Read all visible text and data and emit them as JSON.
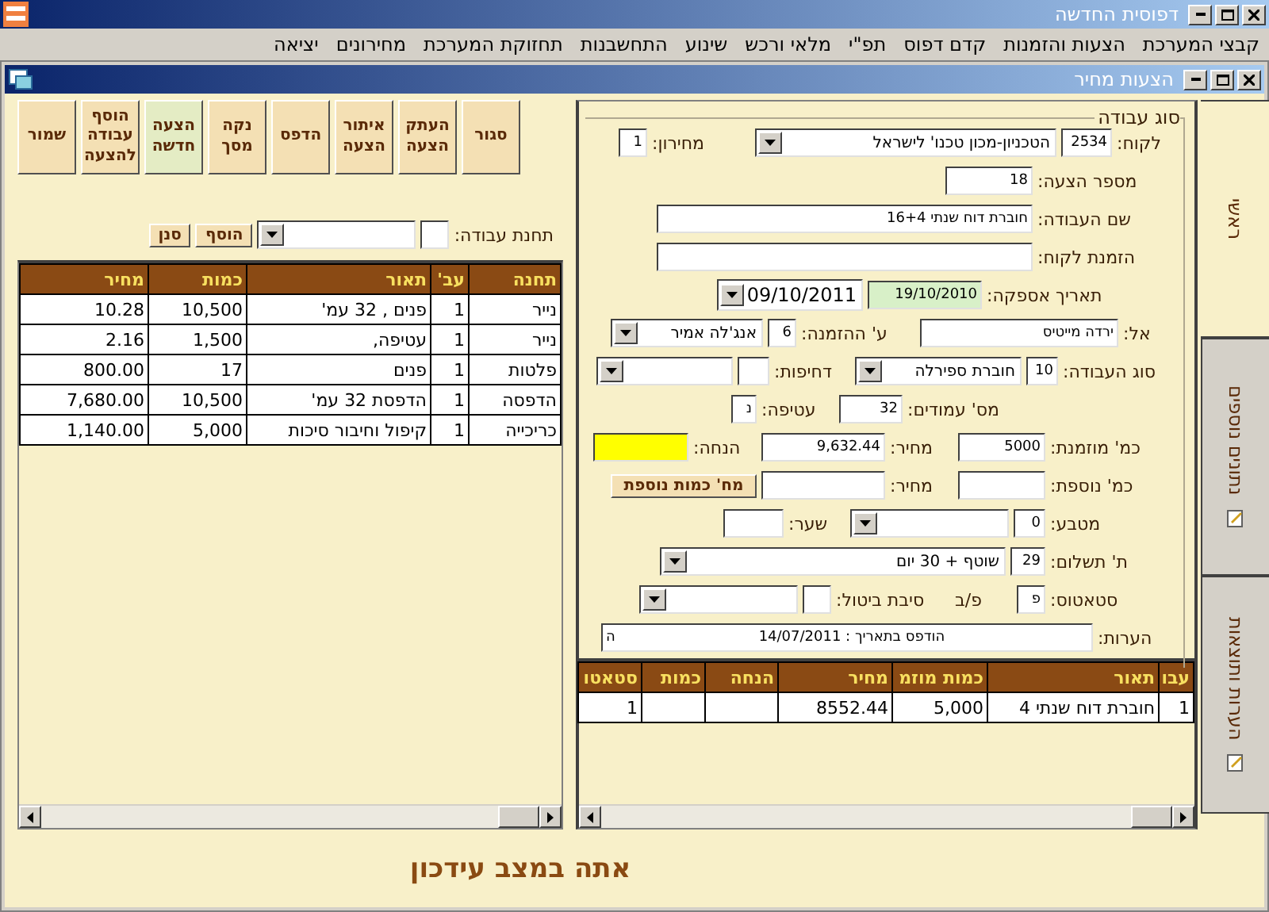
{
  "window": {
    "title": "דפוסית החדשה"
  },
  "menu": [
    "קבצי המערכת",
    "הצעות והזמנות",
    "קדם דפוס",
    "תפ\"י",
    "מלאי ורכש",
    "שינוע",
    "התחשבנות",
    "תחזוקת המערכת",
    "מחירונים",
    "יציאה"
  ],
  "child_window": {
    "title": "הצעות מחיר"
  },
  "tabs": [
    {
      "label": "ראשי",
      "selected": true
    },
    {
      "label": "נתונים נוספים",
      "selected": false
    },
    {
      "label": "הערות ותוצאות",
      "selected": false
    }
  ],
  "form": {
    "legend": "סוג עבודה",
    "rows": [
      {
        "items": [
          {
            "kind": "label",
            "text": "לקוח:"
          },
          {
            "kind": "field",
            "value": "2534"
          },
          {
            "kind": "combo",
            "value": "הטכניון-מכון טכנו' לישראל"
          },
          {
            "kind": "label",
            "text": "מחירון:"
          },
          {
            "kind": "field",
            "value": "1"
          }
        ]
      },
      {
        "items": [
          {
            "kind": "label",
            "text": "מספר הצעה:"
          },
          {
            "kind": "field",
            "value": "18"
          }
        ]
      },
      {
        "items": [
          {
            "kind": "label",
            "text": "שם העבודה:"
          },
          {
            "kind": "field",
            "value": "חוברת דוח שנתי 16+4"
          }
        ]
      },
      {
        "items": [
          {
            "kind": "label",
            "text": "הזמנת לקוח:"
          },
          {
            "kind": "field"
          }
        ]
      },
      {
        "items": [
          {
            "kind": "label",
            "text": "תאריך אספקה:"
          },
          {
            "kind": "field",
            "value": "19/10/2010",
            "color": "#d8f0c8"
          },
          {
            "kind": "date",
            "value": "09/10/2011"
          }
        ]
      },
      {
        "items": [
          {
            "kind": "label",
            "text": "אל:"
          },
          {
            "kind": "field",
            "value": "ירדה מייטיס"
          },
          {
            "kind": "label",
            "text": "ע' ההזמנה:"
          },
          {
            "kind": "field",
            "value": "6"
          },
          {
            "kind": "combo",
            "value": "אנג'לה אמיר"
          }
        ]
      },
      {
        "items": [
          {
            "kind": "label",
            "text": "סוג העבודה:"
          },
          {
            "kind": "field",
            "value": "10"
          },
          {
            "kind": "combo",
            "value": "חוברת ספירלה"
          },
          {
            "kind": "label",
            "text": "דחיפות:"
          },
          {
            "kind": "field"
          },
          {
            "kind": "combo"
          }
        ]
      },
      {
        "items": [
          {
            "kind": "label",
            "text": "מס' עמודים:"
          },
          {
            "kind": "field",
            "value": "32"
          },
          {
            "kind": "label",
            "text": "עטיפה:"
          },
          {
            "kind": "field",
            "value": "נ"
          }
        ]
      },
      {
        "items": [
          {
            "kind": "label",
            "text": "כמ' מוזמנת:"
          },
          {
            "kind": "field",
            "value": "5000"
          },
          {
            "kind": "label",
            "text": "מחיר:"
          },
          {
            "kind": "field",
            "value": "9,632.44"
          },
          {
            "kind": "label",
            "text": "הנחה:"
          },
          {
            "kind": "field",
            "color": "#ffff00"
          }
        ]
      },
      {
        "items": [
          {
            "kind": "label",
            "text": "כמ' נוספת:"
          },
          {
            "kind": "field"
          },
          {
            "kind": "label",
            "text": "מחיר:"
          },
          {
            "kind": "field"
          },
          {
            "kind": "button",
            "text": "מח' כמות נוספת"
          }
        ]
      },
      {
        "items": [
          {
            "kind": "label",
            "text": "מטבע:"
          },
          {
            "kind": "field",
            "value": "0"
          },
          {
            "kind": "combo"
          },
          {
            "kind": "label",
            "text": "שער:"
          },
          {
            "kind": "field"
          }
        ]
      },
      {
        "items": [
          {
            "kind": "label",
            "text": "ת' תשלום:"
          },
          {
            "kind": "field",
            "value": "29"
          },
          {
            "kind": "combo",
            "value": "שוטף + 30 יום"
          }
        ]
      },
      {
        "items": [
          {
            "kind": "label",
            "text": "סטאטוס:"
          },
          {
            "kind": "field",
            "value": "פ"
          },
          {
            "kind": "label",
            "text": "פ/ב"
          },
          {
            "kind": "label",
            "text": "סיבת ביטול:"
          },
          {
            "kind": "field"
          },
          {
            "kind": "combo"
          }
        ]
      }
    ],
    "notes": {
      "label": "הערות:",
      "value": "הודפס בתאריך : 14/07/2011",
      "overflow": "ה"
    }
  },
  "jobs_table": {
    "columns": [
      "עבו",
      "תאור",
      "כמות מוזמ",
      "מחיר",
      "הנחה",
      "כמות",
      "סטאטו"
    ],
    "rows": [
      [
        "1",
        "חוברת דוח שנתי 4",
        "5,000",
        "8552.44",
        "",
        "",
        "1"
      ]
    ]
  },
  "toolbar": [
    {
      "label": "סגור",
      "selected": false
    },
    {
      "label": "העתק הצעה",
      "selected": false
    },
    {
      "label": "איתור הצעה",
      "selected": false
    },
    {
      "label": "הדפס",
      "selected": false
    },
    {
      "label": "נקה מסך",
      "selected": false
    },
    {
      "label": "הצעה חדשה",
      "selected": true
    },
    {
      "label": "הוסף עבודה להצעה",
      "selected": false
    },
    {
      "label": "שמור",
      "selected": false
    }
  ],
  "station": {
    "label": "תחנת עבודה:",
    "buttons": [
      "הוסף",
      "סנן"
    ]
  },
  "stations_table": {
    "columns": [
      "תחנה",
      "עב'",
      "תאור",
      "כמות",
      "מחיר"
    ],
    "rows": [
      [
        "נייר",
        "1",
        "פנים , 32 עמ'",
        "10,500",
        "10.28"
      ],
      [
        "נייר",
        "1",
        "עטיפה,",
        "1,500",
        "2.16"
      ],
      [
        "פלטות",
        "1",
        "פנים",
        "17",
        "800.00"
      ],
      [
        "הדפסה",
        "1",
        "הדפסת 32 עמ'",
        "10,500",
        "7,680.00"
      ],
      [
        "כריכייה",
        "1",
        "קיפול וחיבור סיכות",
        "5,000",
        "1,140.00"
      ]
    ]
  },
  "status": "אתה במצב עידכון"
}
